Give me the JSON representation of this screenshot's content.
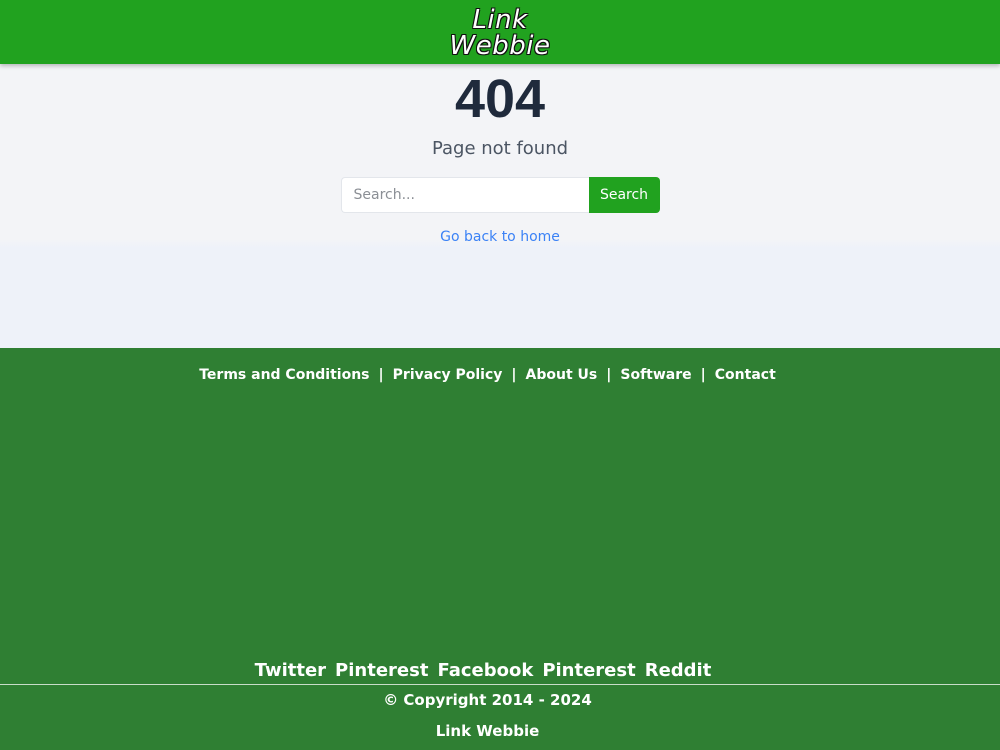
{
  "header": {
    "logo_line1": "Link",
    "logo_line2": "Webbie"
  },
  "main": {
    "error_code": "404",
    "error_message": "Page not found",
    "search": {
      "placeholder": "Search...",
      "value": "",
      "button_label": "Search"
    },
    "home_link_label": "Go back to home"
  },
  "footer": {
    "links": [
      "Terms and Conditions",
      "Privacy Policy",
      "About Us",
      "Software",
      "Contact"
    ],
    "separator": "|",
    "social": [
      "Twitter",
      "Pinterest",
      "Facebook",
      "Pinterest",
      "Reddit"
    ],
    "copyright": "© Copyright 2014 - 2024",
    "site_name": "Link Webbie"
  },
  "colors": {
    "header_green": "#21a21f",
    "footer_green": "#2f7f33",
    "link_blue": "#3b82f6",
    "heading_dark": "#1f2a3c"
  }
}
